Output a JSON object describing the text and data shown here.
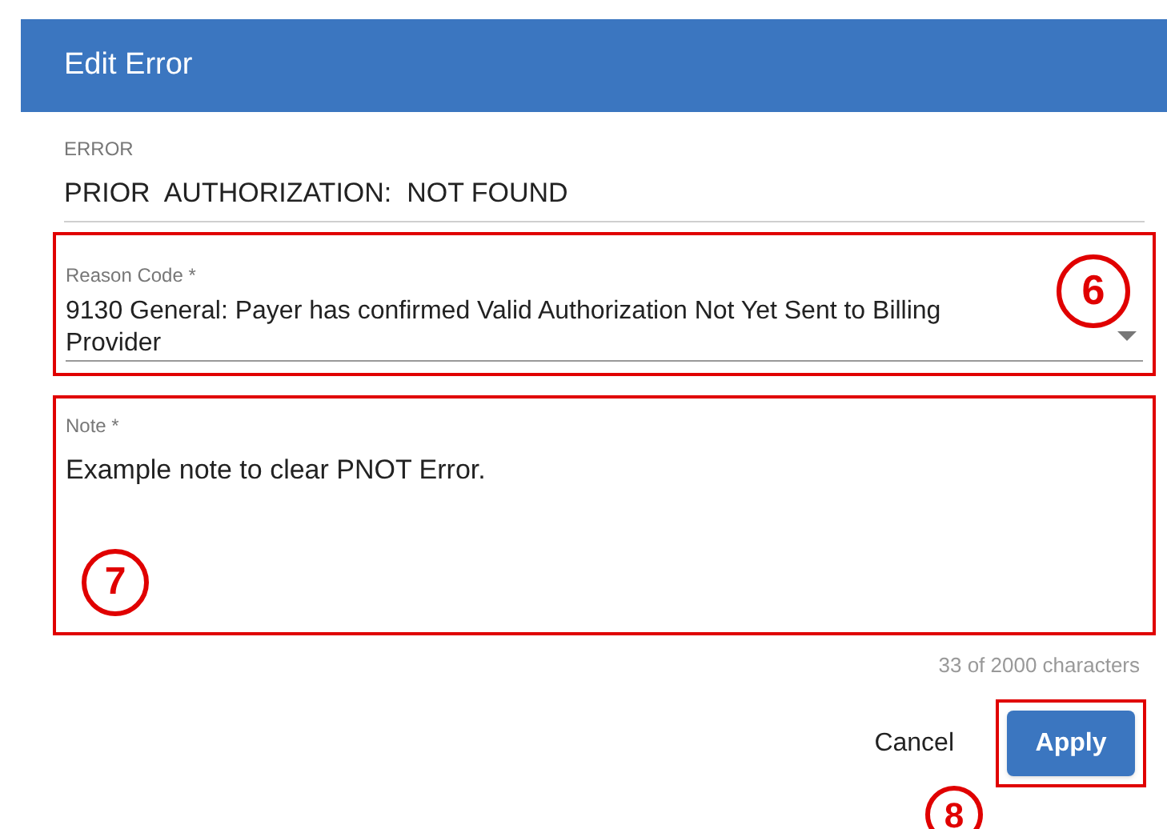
{
  "dialog": {
    "title": "Edit Error"
  },
  "error_field": {
    "label": "ERROR",
    "value": "PRIOR  AUTHORIZATION:  NOT FOUND"
  },
  "reason_code": {
    "label": "Reason Code *",
    "value": "9130 General: Payer has confirmed Valid Authorization Not Yet Sent to Billing Provider",
    "callout": "6"
  },
  "note": {
    "label": "Note *",
    "value": "Example note to clear PNOT Error.",
    "callout": "7",
    "counter": "33 of 2000 characters"
  },
  "buttons": [
    {
      "label": "Cancel",
      "kind": "text"
    },
    {
      "label": "Apply",
      "kind": "primary",
      "callout": "8"
    }
  ]
}
